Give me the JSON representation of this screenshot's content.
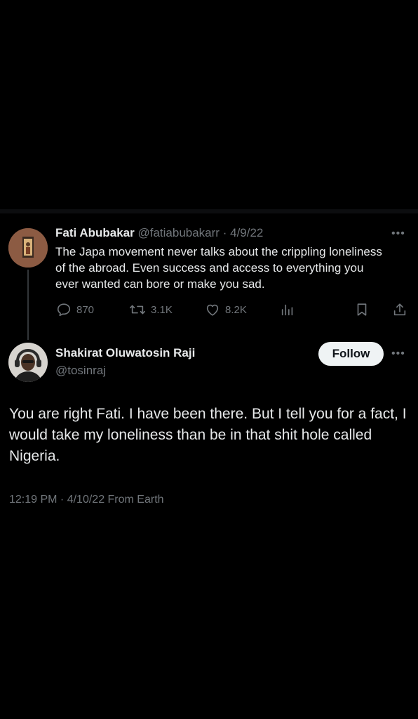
{
  "quoted_tweet": {
    "author_name": "Fati Abubakar",
    "author_handle": "@fatiabubakarr",
    "separator": "·",
    "date": "4/9/22",
    "text": "The Japa movement never talks about the crippling loneliness of the abroad. Even success and access to everything you ever wanted can bore or make you sad.",
    "stats": {
      "replies": "870",
      "retweets": "3.1K",
      "likes": "8.2K"
    }
  },
  "main_tweet": {
    "author_name": "Shakirat Oluwatosin Raji",
    "author_handle": "@tosinraj",
    "follow_label": "Follow",
    "text": "You are right Fati. I have been there. But I tell you for a fact, I would take my loneliness than be in that shit hole called Nigeria.",
    "timestamp": "12:19 PM · 4/10/22 From Earth"
  },
  "icons": {
    "more": "more-icon",
    "reply": "reply-icon",
    "retweet": "retweet-icon",
    "like": "heart-icon",
    "views": "analytics-icon",
    "bookmark": "bookmark-icon",
    "share": "share-icon"
  },
  "colors": {
    "background": "#000000",
    "primary_text": "#e7e9ea",
    "secondary_text": "#71767b",
    "follow_button_bg": "#eff3f4"
  }
}
